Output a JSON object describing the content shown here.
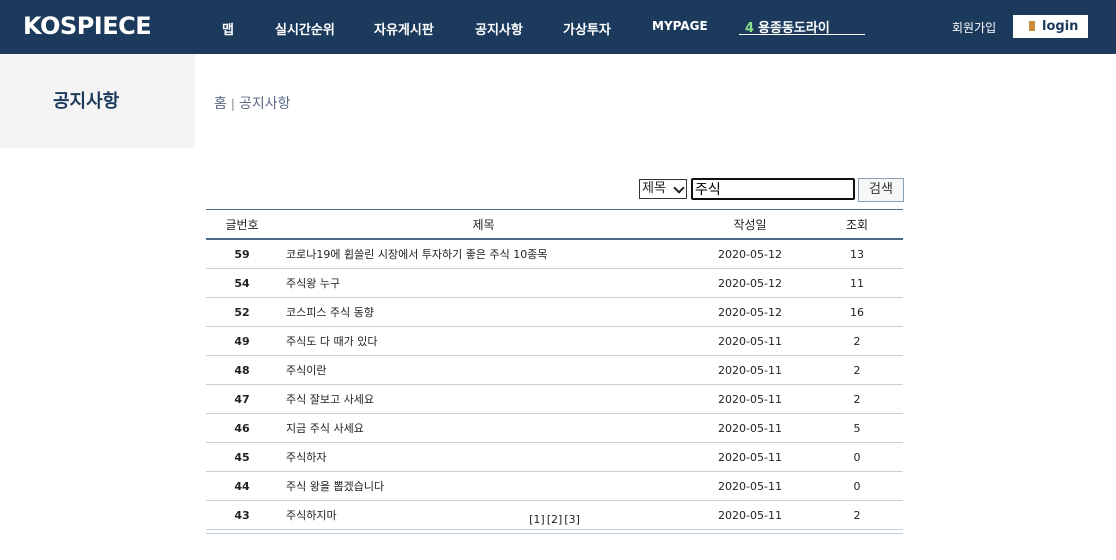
{
  "header": {
    "logo": "KOSPIECE",
    "nav": [
      {
        "label": "맵"
      },
      {
        "label": "실시간순위"
      },
      {
        "label": "자유게시판"
      },
      {
        "label": "공지사항"
      },
      {
        "label": "가상투자"
      },
      {
        "label": "MYPAGE"
      }
    ],
    "ticker": {
      "rank": "4",
      "name": "용종동도라이"
    },
    "signup_label": "회원가입",
    "login_label": "login"
  },
  "page": {
    "title": "공지사항",
    "breadcrumb": {
      "home": "홈",
      "separator": "|",
      "current": "공지사항"
    }
  },
  "search": {
    "field_selected": "제목",
    "query": "주식",
    "button_label": "검색"
  },
  "table": {
    "headers": {
      "no": "글번호",
      "title": "제목",
      "date": "작성일",
      "views": "조회"
    },
    "rows": [
      {
        "no": "59",
        "title": "코로나19에 휩쓸린 시장에서 투자하기 좋은 주식 10종목",
        "date": "2020-05-12",
        "views": "13"
      },
      {
        "no": "54",
        "title": "주식왕 누구",
        "date": "2020-05-12",
        "views": "11"
      },
      {
        "no": "52",
        "title": "코스피스 주식 동향",
        "date": "2020-05-12",
        "views": "16"
      },
      {
        "no": "49",
        "title": "주식도 다 때가 있다",
        "date": "2020-05-11",
        "views": "2"
      },
      {
        "no": "48",
        "title": "주식이란",
        "date": "2020-05-11",
        "views": "2"
      },
      {
        "no": "47",
        "title": "주식 잘보고 사세요",
        "date": "2020-05-11",
        "views": "2"
      },
      {
        "no": "46",
        "title": "지금 주식 사세요",
        "date": "2020-05-11",
        "views": "5"
      },
      {
        "no": "45",
        "title": "주식하자",
        "date": "2020-05-11",
        "views": "0"
      },
      {
        "no": "44",
        "title": "주식 왕을 뽑겠습니다",
        "date": "2020-05-11",
        "views": "0"
      },
      {
        "no": "43",
        "title": "주식하지마",
        "date": "2020-05-11",
        "views": "2"
      }
    ]
  },
  "pagination": [
    "[1]",
    "[2]",
    "[3]"
  ],
  "icons": {
    "login": "door-icon",
    "select": "chevron-down-icon"
  },
  "colors": {
    "header_bg": "#1b3a5c",
    "accent_rank": "#8fe08a",
    "title_color": "#1b3a5c"
  }
}
